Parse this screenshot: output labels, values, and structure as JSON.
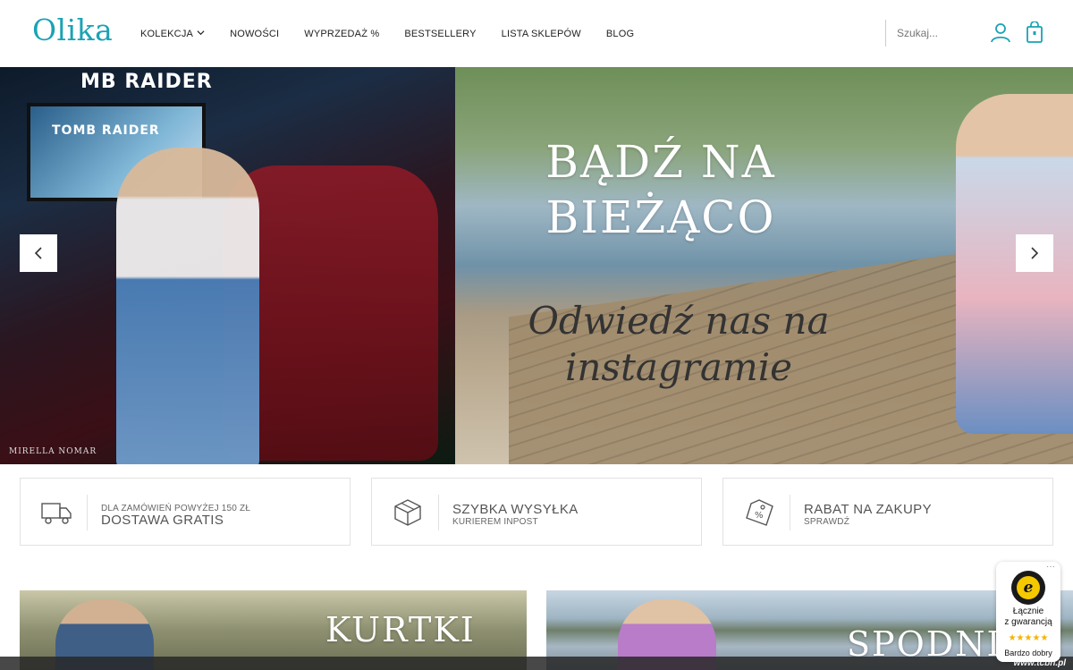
{
  "brand": {
    "logo": "Olika",
    "accent": "#1aa3b4"
  },
  "nav": {
    "items": [
      {
        "label": "KOLEKCJA",
        "has_dropdown": true
      },
      {
        "label": "NOWOŚCI"
      },
      {
        "label": "WYPRZEDAŻ %"
      },
      {
        "label": "BESTSELLERY"
      },
      {
        "label": "LISTA SKLEPÓW"
      },
      {
        "label": "BLOG"
      }
    ]
  },
  "search": {
    "placeholder": "Szukaj..."
  },
  "hero": {
    "headline_line1": "BĄDŹ NA",
    "headline_line2": "BIEŻĄCO",
    "script_line1": "Odwiedź nas na",
    "script_line2": "instagramie",
    "left_watermark": "MIRELLA NOMAR",
    "arcade_title": "TOMB RAIDER",
    "arcade_top": "MB RAIDER",
    "prev_arrow": "‹",
    "next_arrow": "›"
  },
  "features": [
    {
      "icon": "truck-icon",
      "small": "DLA ZAMÓWIEŃ POWYŻEJ 150 ZŁ",
      "big": "DOSTAWA GRATIS"
    },
    {
      "icon": "box-icon",
      "big": "SZYBKA WYSYŁKA",
      "small": "KURIEREM INPOST"
    },
    {
      "icon": "tag-icon",
      "big": "RABAT NA ZAKUPY",
      "small": "SPRAWDŹ"
    }
  ],
  "categories": [
    {
      "label": "KURTKI"
    },
    {
      "label": "SPODNIE"
    }
  ],
  "trust_badge": {
    "menu": "···",
    "logo_letter": "e",
    "line1": "Łącznie",
    "line2": "z gwarancją",
    "stars": "★★★★★",
    "rating_text": "Bardzo dobry"
  },
  "footer_link": "www.tcbn.pl"
}
